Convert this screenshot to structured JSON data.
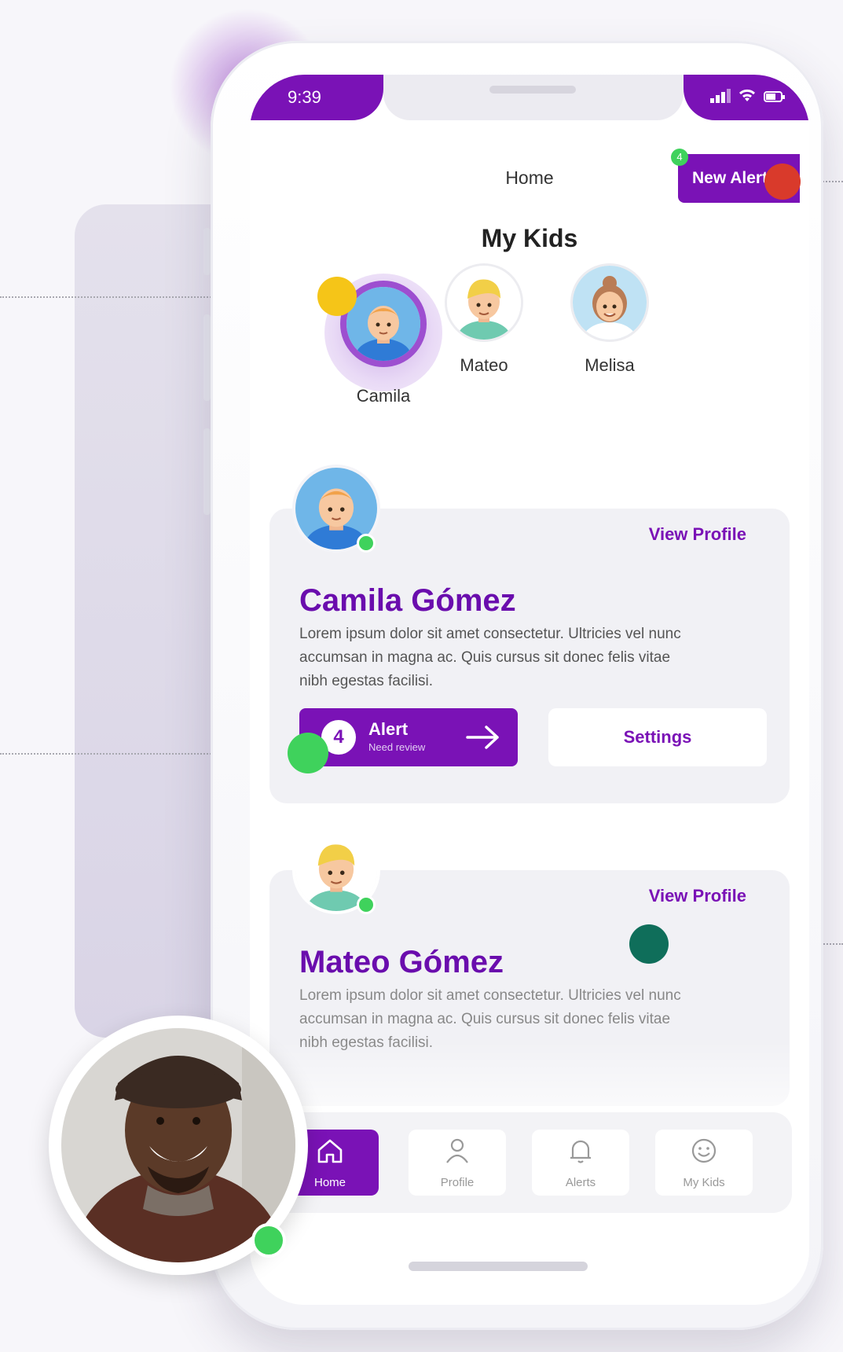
{
  "status_bar": {
    "time": "9:39"
  },
  "header": {
    "title": "Home",
    "new_alert_label": "New Alert",
    "alert_badge": "4"
  },
  "section": {
    "title": "My Kids"
  },
  "kids": [
    {
      "name": "Camila",
      "selected": true
    },
    {
      "name": "Mateo",
      "selected": false
    },
    {
      "name": "Melisa",
      "selected": false
    }
  ],
  "cards": [
    {
      "full_name": "Camila Gómez",
      "view_profile": "View Profile",
      "description": "Lorem ipsum dolor sit amet consectetur. Ultricies vel nunc accumsan in magna ac. Quis cursus sit donec felis vitae nibh egestas facilisi.",
      "alert_count": "4",
      "alert_label": "Alert",
      "alert_sub": "Need review",
      "settings_label": "Settings"
    },
    {
      "full_name": "Mateo Gómez",
      "view_profile": "View Profile",
      "description": "Lorem ipsum dolor sit amet consectetur. Ultricies vel nunc accumsan in magna ac. Quis cursus sit donec felis vitae nibh egestas facilisi."
    }
  ],
  "tabs": [
    {
      "label": "Home",
      "icon": "home-icon",
      "active": true
    },
    {
      "label": "Profile",
      "icon": "user-icon",
      "active": false
    },
    {
      "label": "Alerts",
      "icon": "bell-icon",
      "active": false
    },
    {
      "label": "My Kids",
      "icon": "smile-icon",
      "active": false
    }
  ],
  "colors": {
    "brand": "#7a12b6",
    "online": "#3fd25c",
    "marker_red": "#d93a2b",
    "marker_yellow": "#f5c518",
    "marker_teal": "#0f6e5a"
  }
}
